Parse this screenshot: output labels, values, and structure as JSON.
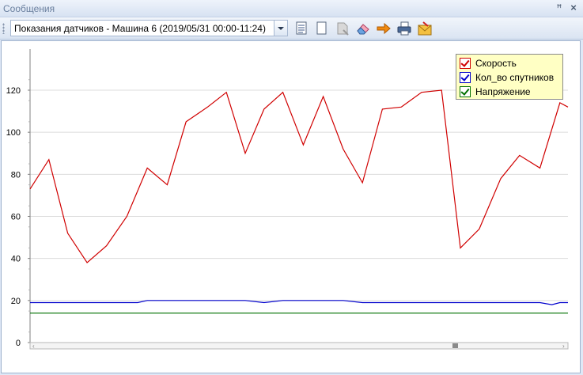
{
  "window": {
    "title": "Сообщения",
    "pin_glyph": "ꟸ",
    "close_glyph": "×"
  },
  "toolbar": {
    "report_select_value": "Показания датчиков - Машина 6 (2019/05/31 00:00-11:24)",
    "buttons": [
      {
        "name": "report-list-icon"
      },
      {
        "name": "blank-page-icon"
      },
      {
        "name": "tag-icon"
      },
      {
        "name": "eraser-icon"
      },
      {
        "name": "arrow-right-icon"
      },
      {
        "name": "print-icon"
      },
      {
        "name": "export-icon"
      }
    ]
  },
  "colors": {
    "speed": "#d00000",
    "satellites": "#0000cc",
    "voltage": "#007000"
  },
  "legend": {
    "items": [
      {
        "label": "Скорость",
        "color": "#d00000",
        "checked": true
      },
      {
        "label": "Кол_во спутников",
        "color": "#0000cc",
        "checked": true
      },
      {
        "label": "Напряжение",
        "color": "#007000",
        "checked": true
      }
    ]
  },
  "chart_data": {
    "type": "line",
    "ylim": [
      0,
      135
    ],
    "y_ticks": [
      0,
      20,
      40,
      60,
      80,
      100,
      120
    ],
    "grid": true,
    "legend_position": "top-right",
    "series": [
      {
        "name": "Скорость",
        "color": "#d00000",
        "values": [
          73,
          87,
          52,
          38,
          46,
          60,
          83,
          75,
          105,
          112,
          119,
          90,
          111,
          119,
          94,
          117,
          92,
          76,
          111,
          112,
          119,
          120,
          45,
          54,
          78,
          89,
          83,
          114,
          112
        ]
      },
      {
        "name": "Кол_во спутников",
        "color": "#0000cc",
        "values": [
          19,
          19,
          19,
          19,
          19,
          19,
          19,
          20,
          20,
          20,
          20,
          20,
          20,
          19,
          20,
          20,
          20,
          20,
          19,
          19,
          19,
          19,
          19,
          19,
          19,
          19,
          19,
          19,
          18,
          19,
          19
        ]
      },
      {
        "name": "Напряжение",
        "color": "#007000",
        "values": [
          14,
          14
        ]
      }
    ],
    "speed_x": [
      0,
      0.035,
      0.07,
      0.106,
      0.142,
      0.18,
      0.218,
      0.255,
      0.29,
      0.33,
      0.365,
      0.4,
      0.435,
      0.47,
      0.508,
      0.545,
      0.582,
      0.618,
      0.655,
      0.69,
      0.728,
      0.765,
      0.8,
      0.835,
      0.875,
      0.91,
      0.948,
      0.985,
      1.0
    ],
    "sat_x": [
      0,
      0.035,
      0.07,
      0.106,
      0.142,
      0.18,
      0.2,
      0.218,
      0.255,
      0.29,
      0.33,
      0.365,
      0.4,
      0.435,
      0.47,
      0.508,
      0.545,
      0.582,
      0.618,
      0.655,
      0.69,
      0.728,
      0.765,
      0.8,
      0.835,
      0.875,
      0.91,
      0.948,
      0.97,
      0.985,
      1.0
    ],
    "volt_x": [
      0,
      1.0
    ]
  }
}
